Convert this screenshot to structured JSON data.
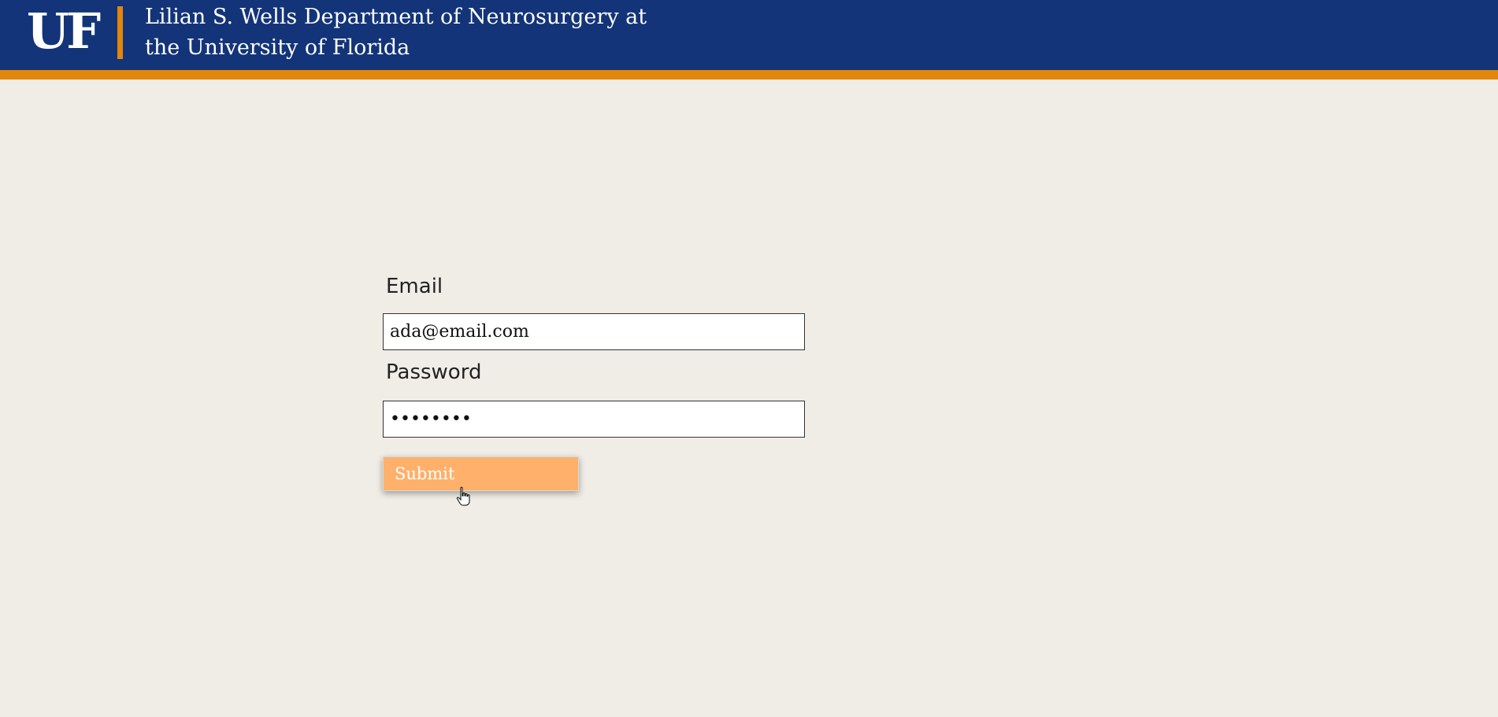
{
  "header": {
    "logo_text": "UF",
    "title_line1": "Lilian S. Wells Department of Neurosurgery at",
    "title_line2": "the University of Florida",
    "colors": {
      "header_bg": "#133478",
      "accent": "#e2870c"
    }
  },
  "login_form": {
    "email_label": "Email",
    "email_value": "ada@email.com",
    "password_label": "Password",
    "password_value": "••••••••",
    "submit_label": "Submit",
    "submit_color": "#ffb06a"
  },
  "page": {
    "background": "#f0ede6"
  }
}
